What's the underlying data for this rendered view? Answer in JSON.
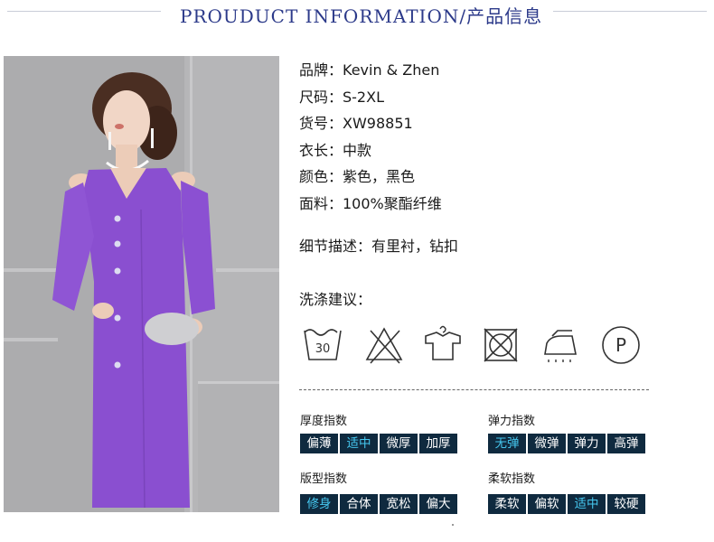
{
  "header": {
    "title": "PROUDUCT INFORMATION/产品信息"
  },
  "info": [
    "品牌：Kevin & Zhen",
    "尺码：S-2XL",
    "货号：XW98851",
    "衣长：中款",
    "颜色：紫色，黑色",
    "面料：100%聚酯纤维"
  ],
  "detail": "细节描述：有里衬，钻扣",
  "wash": {
    "title": "洗涤建议：",
    "icons": [
      "wash-30-icon",
      "no-bleach-icon",
      "hang-dry-icon",
      "no-tumble-dry-icon",
      "low-iron-icon",
      "dry-clean-p-icon"
    ],
    "temp": "30",
    "pro_letter": "P"
  },
  "indices": {
    "thickness": {
      "label": "厚度指数",
      "options": [
        "偏薄",
        "适中",
        "微厚",
        "加厚"
      ],
      "selected": "适中"
    },
    "elasticity": {
      "label": "弹力指数",
      "options": [
        "无弹",
        "微弹",
        "弹力",
        "高弹"
      ],
      "selected": "无弹"
    },
    "fit": {
      "label": "版型指数",
      "options": [
        "修身",
        "合体",
        "宽松",
        "偏大"
      ],
      "selected": "修身"
    },
    "softness": {
      "label": "柔软指数",
      "options": [
        "柔软",
        "偏软",
        "适中",
        "较硬"
      ],
      "selected": "适中"
    }
  },
  "colors": {
    "title": "#2c3a8a",
    "scale_bg": "#0f2a3f",
    "scale_selected": "#46c8f0",
    "dress": "#8a4fd0"
  }
}
